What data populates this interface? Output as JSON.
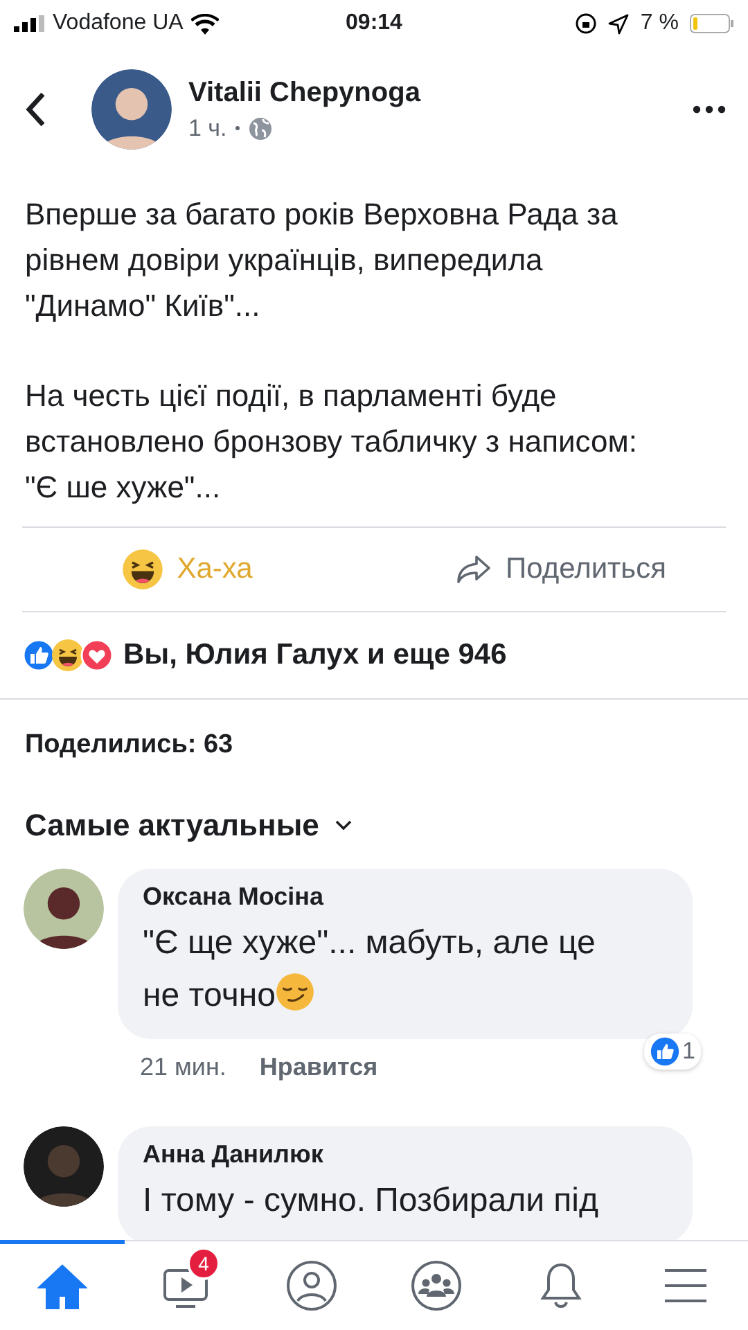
{
  "status_bar": {
    "carrier": "Vodafone UA",
    "time": "09:14",
    "battery": "7 %"
  },
  "header": {
    "author": "Vitalii Chepynoga",
    "time": "1 ч."
  },
  "post": {
    "paragraphs": [
      "Вперше за багато років Верховна Рада за рівнем довіри українців, випередила \"Динамо\" Київ\"...",
      "На честь цієї події, в парламенті буде встановлено бронзову табличку з написом: \"Є ше хуже\"..."
    ]
  },
  "actions": [
    {
      "kind": "haha",
      "label": "Ха-ха",
      "selected": true
    },
    {
      "kind": "share",
      "label": "Поделиться",
      "selected": false
    }
  ],
  "reactions": {
    "summary": "Вы, Юлия Галух и еще 946"
  },
  "shares": "Поделились: 63",
  "sort": {
    "label": "Самые актуальные"
  },
  "comments": [
    {
      "author": "Оксана Мосіна",
      "text": "\"Є ще хуже\"... мабуть, але це не точно",
      "trailing_emoji": true,
      "time": "21 мин.",
      "like_label": "Нравится",
      "like_count": "1"
    },
    {
      "author": "Анна Данилюк",
      "text": "І тому - сумно. Позбирали під"
    }
  ],
  "tab_bar": [
    {
      "kind": "home",
      "selected": true
    },
    {
      "kind": "video",
      "selected": false,
      "badge": "4"
    },
    {
      "kind": "profile",
      "selected": false
    },
    {
      "kind": "groups",
      "selected": false
    },
    {
      "kind": "bell",
      "selected": false
    },
    {
      "kind": "menu",
      "selected": false
    }
  ]
}
